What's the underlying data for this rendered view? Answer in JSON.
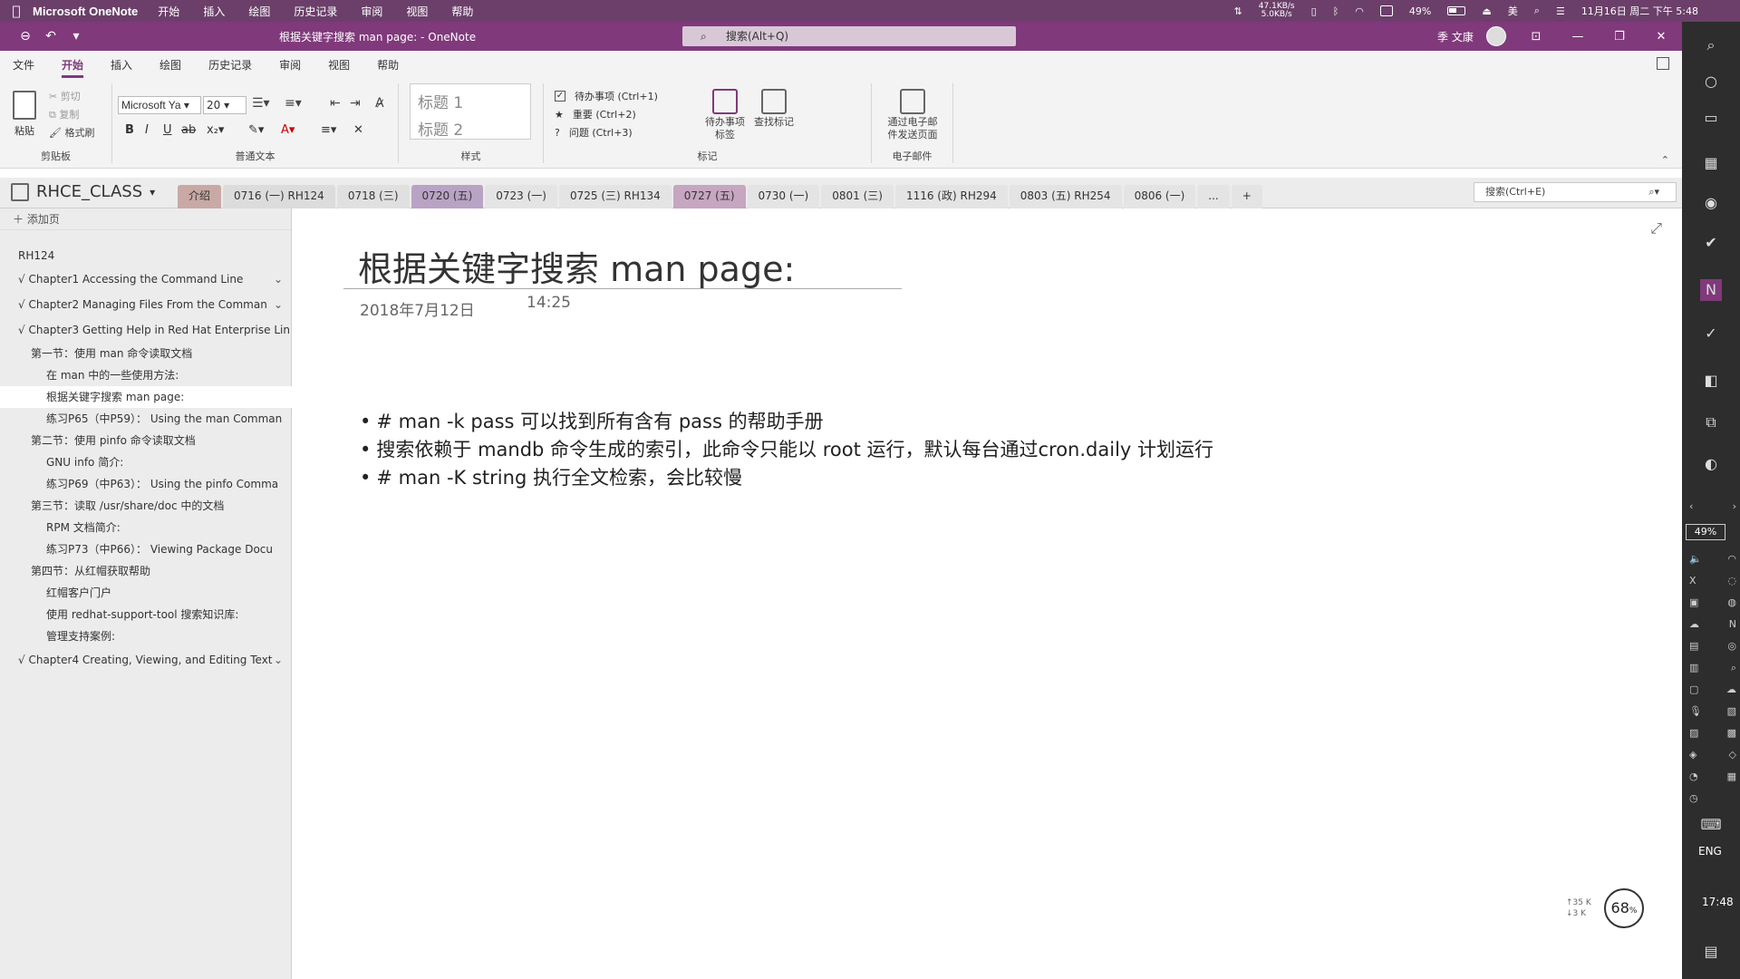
{
  "macbar": {
    "app_name": "Microsoft OneNote",
    "menus": [
      "开始",
      "插入",
      "绘图",
      "历史记录",
      "审阅",
      "视图",
      "帮助"
    ],
    "net_up": "47.1KB/s",
    "net_down": "5.0KB/s",
    "battery": "49%",
    "clock": "11月16日 周二 下午 5:48"
  },
  "titlebar": {
    "doc_title": "根据关键字搜索 man page:  - OneNote",
    "search_placeholder": "搜索(Alt+Q)",
    "user": "季 文康"
  },
  "ribbon_tabs": [
    "文件",
    "开始",
    "插入",
    "绘图",
    "历史记录",
    "审阅",
    "视图",
    "帮助"
  ],
  "ribbon": {
    "clipboard": {
      "paste": "粘贴",
      "cut": "剪切",
      "copy": "复制",
      "format_painter": "格式刷",
      "label": "剪贴板"
    },
    "text": {
      "font": "Microsoft Ya",
      "size": "20",
      "label": "普通文本"
    },
    "styles": {
      "h1": "标题 1",
      "h2": "标题 2",
      "label": "样式"
    },
    "tags": {
      "todo": "待办事项 (Ctrl+1)",
      "important": "重要 (Ctrl+2)",
      "question": "问题 (Ctrl+3)",
      "todo_tag": "待办事项\n标签",
      "find_tags": "查找标记",
      "label": "标记"
    },
    "email": {
      "send": "通过电子邮\n件发送页面",
      "label": "电子邮件"
    }
  },
  "notebook": {
    "name": "RHCE_CLASS",
    "sections": [
      {
        "label": "介绍",
        "color": "#c9a9a6"
      },
      {
        "label": "0716 (一) RH124",
        "color": "#dcdcdc"
      },
      {
        "label": "0718 (三)",
        "color": "#e0e0e0"
      },
      {
        "label": "0720 (五)",
        "color": "#b8a3c4"
      },
      {
        "label": "0723 (一)",
        "color": "#e4e4e4"
      },
      {
        "label": "0725 (三) RH134",
        "color": "#e4e4e4"
      },
      {
        "label": "0727 (五)",
        "color": "#c6a6c0"
      },
      {
        "label": "0730 (一)",
        "color": "#e4e4e4"
      },
      {
        "label": "0801 (三)",
        "color": "#e4e4e4"
      },
      {
        "label": "1116 (政) RH294",
        "color": "#e4e4e4"
      },
      {
        "label": "0803 (五) RH254",
        "color": "#e4e4e4"
      },
      {
        "label": "0806 (一)",
        "color": "#e4e4e4"
      },
      {
        "label": "...",
        "color": "#e4e4e4"
      },
      {
        "label": "+",
        "color": "#e4e4e4"
      }
    ],
    "search_placeholder": "搜索(Ctrl+E)"
  },
  "pages": {
    "add_page": "添加页",
    "items": [
      {
        "label": "RH124",
        "level": 0
      },
      {
        "label": "√ Chapter1 Accessing the Command Line",
        "level": 1,
        "chevron": true
      },
      {
        "label": "√ Chapter2 Managing Files From the Comman",
        "level": 1,
        "chevron": true
      },
      {
        "label": "√ Chapter3 Getting Help in Red Hat Enterprise Lin",
        "level": 1
      },
      {
        "label": "第一节：使用 man 命令读取文档",
        "level": 2
      },
      {
        "label": "在 man 中的一些使用方法:",
        "level": 3
      },
      {
        "label": "根据关键字搜索 man page:",
        "level": 3,
        "selected": true
      },
      {
        "label": "练习P65（中P59）： Using the man Comman",
        "level": 3
      },
      {
        "label": "第二节：使用 pinfo 命令读取文档",
        "level": 2
      },
      {
        "label": "GNU info 简介:",
        "level": 3
      },
      {
        "label": "练习P69（中P63）： Using the pinfo Comma",
        "level": 3
      },
      {
        "label": "第三节：读取 /usr/share/doc 中的文档",
        "level": 2
      },
      {
        "label": "RPM 文档简介:",
        "level": 3
      },
      {
        "label": "练习P73（中P66）： Viewing Package Docu",
        "level": 3
      },
      {
        "label": "第四节：从红帽获取帮助",
        "level": 2
      },
      {
        "label": "红帽客户门户",
        "level": 3
      },
      {
        "label": "使用 redhat-support-tool 搜索知识库:",
        "level": 3
      },
      {
        "label": "管理支持案例:",
        "level": 3
      },
      {
        "label": "√ Chapter4 Creating, Viewing, and Editing Text",
        "level": 1,
        "chevron": true
      }
    ]
  },
  "page": {
    "title": "根据关键字搜索 man page:",
    "date": "2018年7月12日",
    "time": "14:25",
    "bullets": [
      "# man -k pass 可以找到所有含有 pass 的帮助手册",
      "搜索依赖于 mandb 命令生成的索引，此命令只能以 root 运行，默认每台通过cron.daily 计划运行",
      "# man -K string 执行全文检索，会比较慢"
    ]
  },
  "sidestrip": {
    "battery_pct": "49%",
    "lang": "ENG",
    "clock": "17:48"
  },
  "perf": {
    "value": "68",
    "unit": "%",
    "up": "↑35 K",
    "down": "↓3 K"
  }
}
